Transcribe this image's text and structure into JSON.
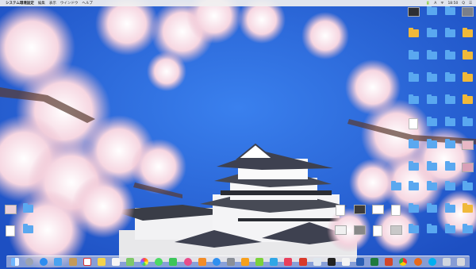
{
  "menubar": {
    "apple": "",
    "app_name": "システム環境設定",
    "menus": [
      "編集",
      "表示",
      "ウインドウ",
      "ヘルプ"
    ],
    "status": [
      "🔋",
      "A",
      "ᯤ",
      "18:50",
      "Q",
      "☰"
    ]
  },
  "colors": {
    "sky": "#2f6fe0",
    "blossom": "#f6d4df",
    "folder": "#5aa8f0"
  },
  "dock_icons": [
    "finder",
    "launchpad",
    "safari",
    "mail",
    "contacts",
    "calendar",
    "notes",
    "reminders",
    "maps",
    "photos",
    "messages",
    "facetime",
    "itunes",
    "ibooks",
    "appstore",
    "preferences",
    "illustrator",
    "dreamweaver",
    "photoshop",
    "indesign",
    "acrobat",
    "preview",
    "terminal",
    "textedit",
    "word",
    "excel",
    "powerpoint",
    "chrome",
    "firefox",
    "skype",
    "downloads",
    "trash"
  ]
}
